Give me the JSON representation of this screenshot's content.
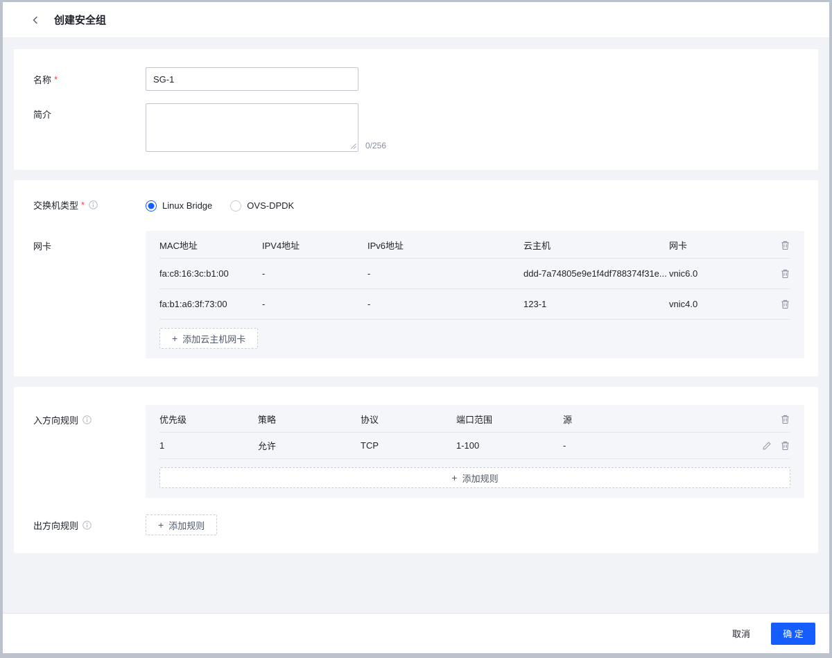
{
  "header": {
    "title": "创建安全组"
  },
  "form": {
    "name": {
      "label": "名称",
      "required": "*",
      "value": "SG-1"
    },
    "description": {
      "label": "简介",
      "value": "",
      "counter": "0/256"
    }
  },
  "network": {
    "switch_type": {
      "label": "交换机类型",
      "required": "*",
      "options": [
        {
          "label": "Linux Bridge",
          "selected": true
        },
        {
          "label": "OVS-DPDK",
          "selected": false
        }
      ]
    },
    "nic": {
      "label": "网卡",
      "columns": [
        "MAC地址",
        "IPV4地址",
        "IPv6地址",
        "云主机",
        "网卡"
      ],
      "rows": [
        {
          "mac": "fa:c8:16:3c:b1:00",
          "ipv4": "-",
          "ipv6": "-",
          "host": "ddd-7a74805e9e1f4df788374f31e...",
          "nic": "vnic6.0"
        },
        {
          "mac": "fa:b1:a6:3f:73:00",
          "ipv4": "-",
          "ipv6": "-",
          "host": "123-1",
          "nic": "vnic4.0"
        }
      ],
      "add_label": "添加云主机网卡"
    }
  },
  "rules": {
    "inbound": {
      "label": "入方向规则",
      "columns": [
        "优先级",
        "策略",
        "协议",
        "端口范围",
        "源"
      ],
      "rows": [
        {
          "priority": "1",
          "policy": "允许",
          "protocol": "TCP",
          "port_range": "1-100",
          "source": "-"
        }
      ],
      "add_label": "添加规则"
    },
    "outbound": {
      "label": "出方向规则",
      "add_label": "添加规则"
    }
  },
  "footer": {
    "cancel": "取消",
    "confirm": "确 定"
  },
  "icons": {
    "plus": "+"
  },
  "colors": {
    "primary": "#165dff",
    "required_red": "#f53f3f",
    "muted": "#86909c",
    "panel_bg": "#ffffff",
    "table_bg": "#f5f6f9"
  }
}
